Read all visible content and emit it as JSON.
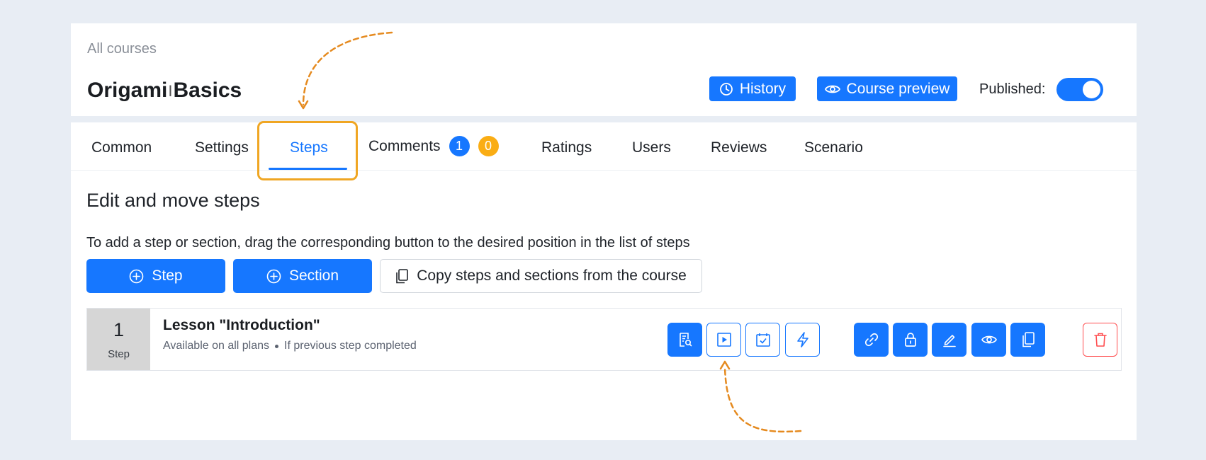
{
  "header": {
    "breadcrumb": "All courses",
    "title_part1": "Origami",
    "title_part2": "Basics",
    "history_label": "History",
    "preview_label": "Course preview",
    "published_label": "Published",
    "published_on": true
  },
  "tabs": [
    {
      "label": "Common"
    },
    {
      "label": "Settings"
    },
    {
      "label": "Steps",
      "active": true
    },
    {
      "label": "Comments",
      "badge_blue": "1",
      "badge_orange": "0"
    },
    {
      "label": "Ratings"
    },
    {
      "label": "Users"
    },
    {
      "label": "Reviews"
    },
    {
      "label": "Scenario"
    }
  ],
  "main": {
    "section_title": "Edit and move steps",
    "hint": "To add a step or section, drag the corresponding button to the desired position in the list of steps",
    "add_step_label": "Step",
    "add_section_label": "Section",
    "copy_label": "Copy steps and sections from the course"
  },
  "step": {
    "number": "1",
    "number_label": "Step",
    "name": "Lesson \"Introduction\"",
    "availability": "Available on all plans",
    "condition": "If previous step completed"
  },
  "colors": {
    "accent": "#1677ff",
    "badge_orange": "#faad14",
    "highlight": "#f0a623",
    "danger": "#ff4d4f"
  }
}
